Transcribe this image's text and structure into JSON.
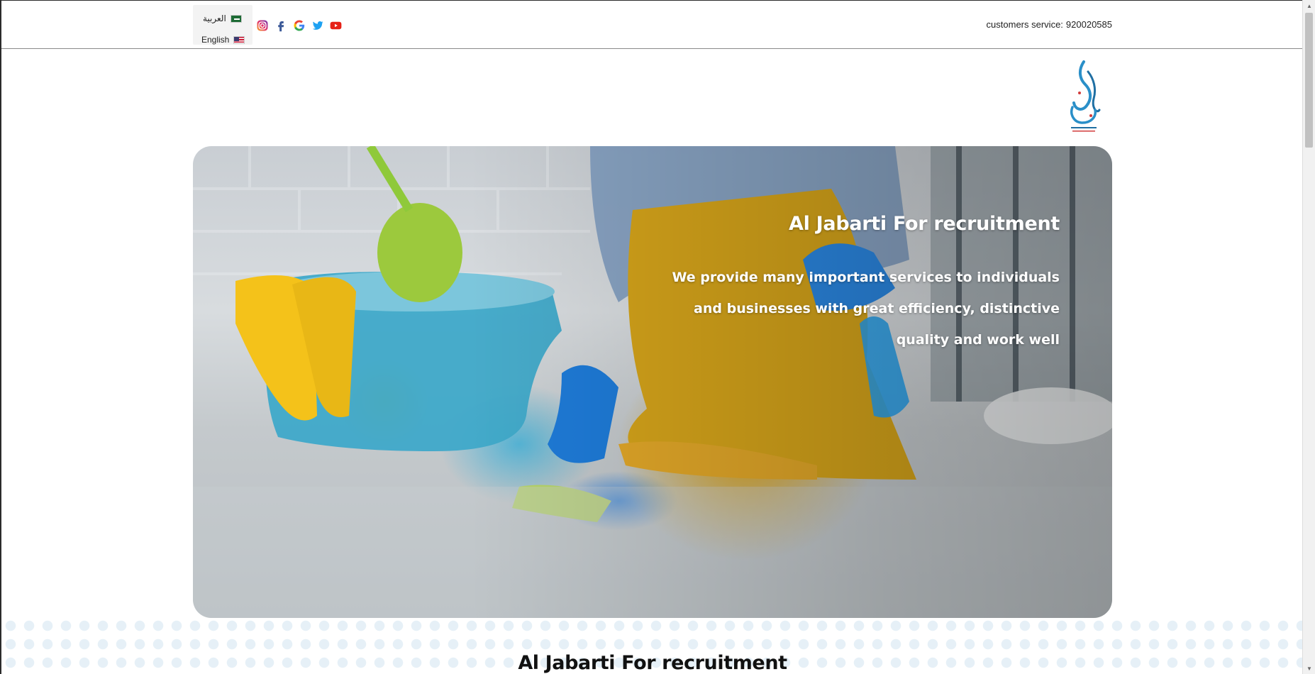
{
  "header": {
    "languages": [
      {
        "label": "العربية",
        "flag": "saudi-arabia"
      },
      {
        "label": "English",
        "flag": "united-states"
      }
    ],
    "social": [
      "instagram-icon",
      "facebook-icon",
      "google-icon",
      "twitter-icon",
      "youtube-icon"
    ],
    "customer_service": {
      "label": "customers service:",
      "number": "920020585"
    }
  },
  "logo": {
    "name": "Al Jabarti logo"
  },
  "hero": {
    "title": "Al Jabarti For recruitment",
    "subtitle_lines": [
      "We provide many important services to individuals",
      "and businesses with great efficiency, distinctive",
      "quality and work well"
    ]
  },
  "section": {
    "title": "Al Jabarti For recruitment"
  },
  "colors": {
    "accent": "#1a78b8",
    "hero_text": "#ffffff",
    "divider": "#8a8a8a"
  }
}
